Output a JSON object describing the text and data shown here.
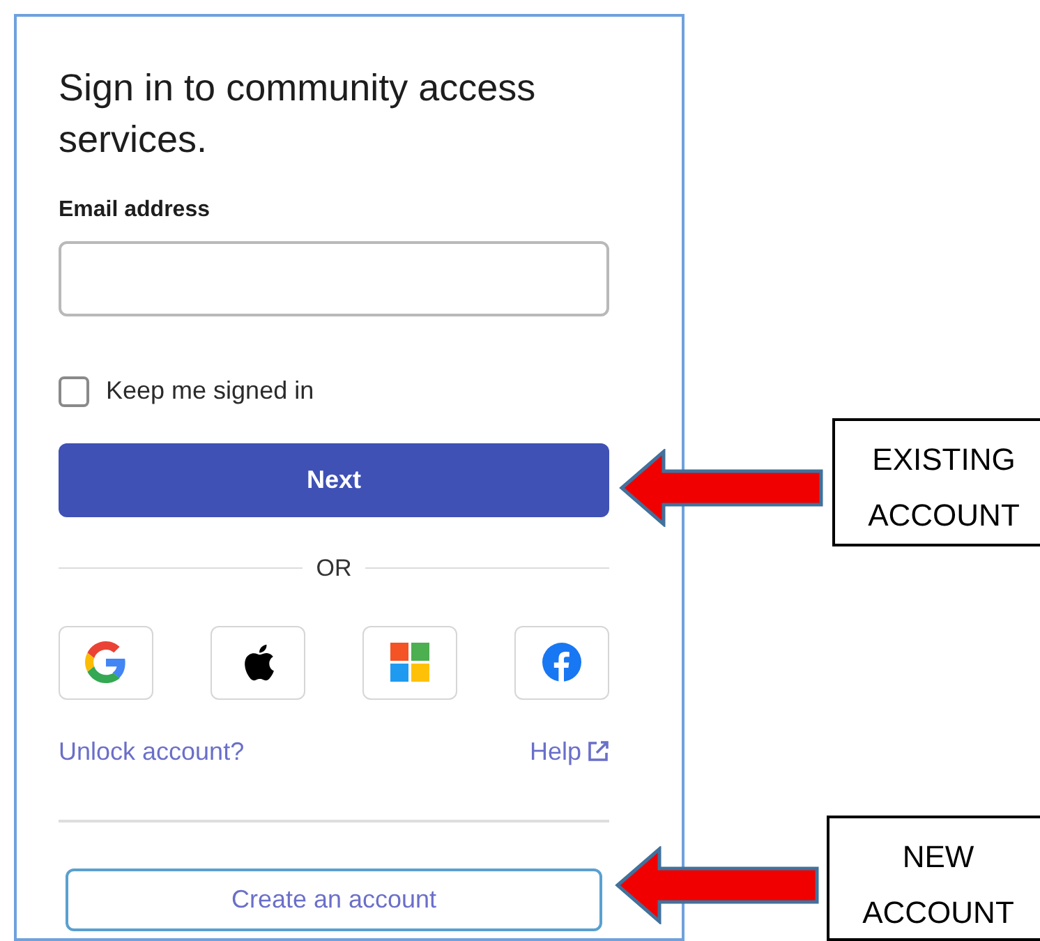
{
  "heading": "Sign in to community access services.",
  "email": {
    "label": "Email address"
  },
  "keep_signed_in": {
    "label": "Keep me signed in",
    "checked": false
  },
  "next_button": "Next",
  "separator": "OR",
  "social_buttons": [
    {
      "kind": "google"
    },
    {
      "kind": "apple"
    },
    {
      "kind": "microsoft"
    },
    {
      "kind": "facebook"
    }
  ],
  "links": [
    {
      "kind": "unlock",
      "label": "Unlock account?"
    },
    {
      "kind": "help",
      "label": "Help"
    }
  ],
  "create_button": "Create an account",
  "callouts": [
    {
      "text": "EXISTING ACCOUNT",
      "kind": "next"
    },
    {
      "text": "NEW ACCOUNT",
      "kind": "create"
    }
  ]
}
